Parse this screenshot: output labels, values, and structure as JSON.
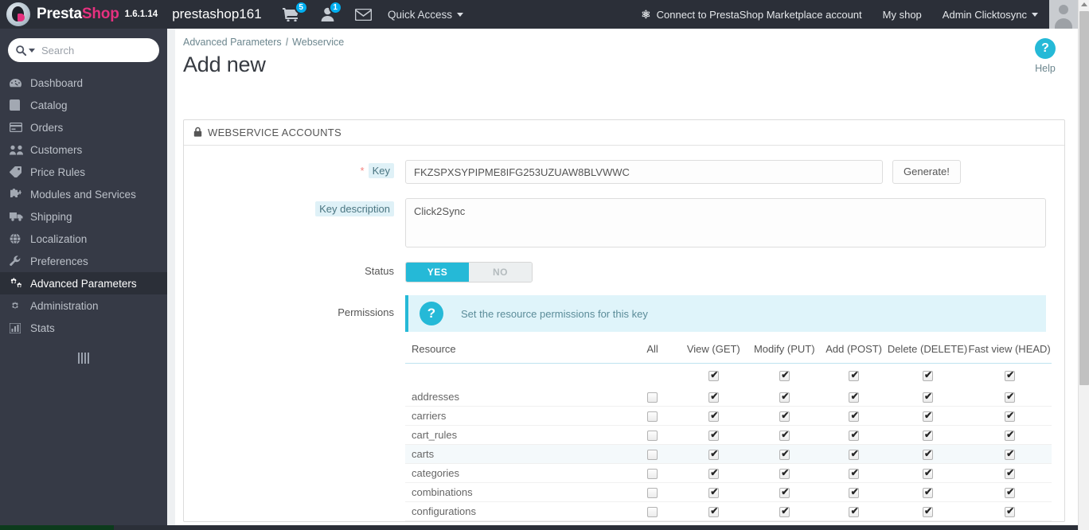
{
  "topbar": {
    "brand_first": "Presta",
    "brand_second": "Shop",
    "version": "1.6.1.14",
    "shop_name": "prestashop161",
    "cart_badge": "5",
    "customer_badge": "1",
    "cart_icon": "shopping-cart-icon",
    "customer_icon": "user-icon",
    "message_icon": "envelope-icon",
    "quick_access": "Quick Access",
    "marketplace": "Connect to PrestaShop Marketplace account",
    "my_shop": "My shop",
    "account": "Admin Clicktosync"
  },
  "sidebar": {
    "search_placeholder": "Search",
    "search_value": "",
    "items": [
      {
        "label": "Dashboard",
        "icon": "dashboard-icon",
        "active": false
      },
      {
        "label": "Catalog",
        "icon": "book-icon",
        "active": false
      },
      {
        "label": "Orders",
        "icon": "credit-card-icon",
        "active": false
      },
      {
        "label": "Customers",
        "icon": "users-icon",
        "active": false
      },
      {
        "label": "Price Rules",
        "icon": "tag-icon",
        "active": false
      },
      {
        "label": "Modules and Services",
        "icon": "puzzle-icon",
        "active": false
      },
      {
        "label": "Shipping",
        "icon": "truck-icon",
        "active": false
      },
      {
        "label": "Localization",
        "icon": "globe-icon",
        "active": false
      },
      {
        "label": "Preferences",
        "icon": "wrench-icon",
        "active": false
      },
      {
        "label": "Advanced Parameters",
        "icon": "cogs-icon",
        "active": true
      },
      {
        "label": "Administration",
        "icon": "gear-icon",
        "active": false
      },
      {
        "label": "Stats",
        "icon": "bar-chart-icon",
        "active": false
      }
    ]
  },
  "page": {
    "breadcrumb_parent": "Advanced Parameters",
    "breadcrumb_sep": "/",
    "breadcrumb_current": "Webservice",
    "title": "Add new",
    "help_label": "Help",
    "help_icon": "question-circle-icon"
  },
  "panel": {
    "title": "WEBSERVICE ACCOUNTS",
    "lock_icon": "lock-icon"
  },
  "form": {
    "key_label": "Key",
    "key_required": "*",
    "key_value": "FKZSPXSYPIPME8IFG253UZUAW8BLVWWC",
    "generate_label": "Generate!",
    "description_label": "Key description",
    "description_value": "Click2Sync",
    "status_label": "Status",
    "status_yes": "YES",
    "status_no": "NO",
    "status_selected": "YES",
    "permissions_label": "Permissions",
    "permissions_hint": "Set the resource permissions for this key"
  },
  "permissions_table": {
    "columns": [
      "Resource",
      "All",
      "View (GET)",
      "Modify (PUT)",
      "Add (POST)",
      "Delete (DELETE)",
      "Fast view (HEAD)"
    ],
    "header_row_checks": {
      "all": null,
      "get": true,
      "put": true,
      "post": true,
      "delete": true,
      "head": true
    },
    "rows": [
      {
        "resource": "addresses",
        "all": false,
        "get": true,
        "put": true,
        "post": true,
        "delete": true,
        "head": true,
        "highlight": false
      },
      {
        "resource": "carriers",
        "all": false,
        "get": true,
        "put": true,
        "post": true,
        "delete": true,
        "head": true,
        "highlight": false
      },
      {
        "resource": "cart_rules",
        "all": false,
        "get": true,
        "put": true,
        "post": true,
        "delete": true,
        "head": true,
        "highlight": false
      },
      {
        "resource": "carts",
        "all": false,
        "get": true,
        "put": true,
        "post": true,
        "delete": true,
        "head": true,
        "highlight": true
      },
      {
        "resource": "categories",
        "all": false,
        "get": true,
        "put": true,
        "post": true,
        "delete": true,
        "head": true,
        "highlight": false
      },
      {
        "resource": "combinations",
        "all": false,
        "get": true,
        "put": true,
        "post": true,
        "delete": true,
        "head": true,
        "highlight": false
      },
      {
        "resource": "configurations",
        "all": false,
        "get": true,
        "put": true,
        "post": true,
        "delete": true,
        "head": true,
        "highlight": false
      }
    ]
  },
  "colors": {
    "topbar_bg": "#2b2f38",
    "sidebar_bg": "#363a46",
    "accent": "#25b9d7",
    "brand_pink": "#e5317f",
    "badge_blue": "#00aff0",
    "label_highlight": "#dff1f7"
  }
}
